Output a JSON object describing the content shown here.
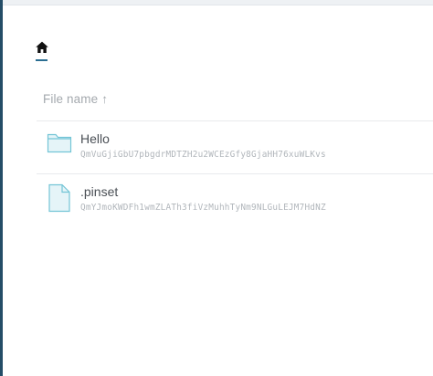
{
  "header": {
    "home_icon": "home-icon"
  },
  "list": {
    "column_name": "File name",
    "sort_indicator": "↑"
  },
  "files": [
    {
      "type": "folder",
      "icon": "folder-icon",
      "name": "Hello",
      "cid": "QmVuGjiGbU7pbgdrMDTZH2u2WCEzGfy8GjaHH76xuWLKvs"
    },
    {
      "type": "file",
      "icon": "file-icon",
      "name": ".pinset",
      "cid": "QmYJmoKWDFh1wmZLATh3fiVzMuhhTyNm9NLGuLEJM7HdNZ"
    }
  ],
  "colors": {
    "accent": "#2b6e92",
    "icon_fill": "#e5f4f8",
    "icon_stroke": "#74c5d6",
    "sidebar_edge": "#244d67"
  }
}
